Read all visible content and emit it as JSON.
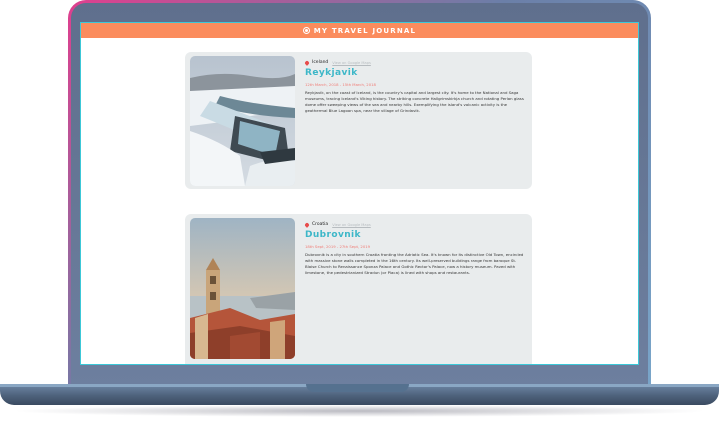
{
  "app": {
    "title": "MY TRAVEL JOURNAL"
  },
  "entries": [
    {
      "country": "Iceland",
      "map_link": "View on Google Maps",
      "title": "Reykjavik",
      "dates": "12th March, 2018 - 15th March, 2018",
      "description": "Reykjavik, on the coast of Iceland, is the country's capital and largest city. It's home to the National and Saga museums, tracing Iceland's Viking history. The striking concrete Hallgrimskirkja church and rotating Perlan glass dome offer sweeping views of the sea and nearby hills. Exemplifying the island's volcanic activity is the geothermal Blue Lagoon spa, near the village of Grindavik."
    },
    {
      "country": "Croatia",
      "map_link": "View on Google Maps",
      "title": "Dubrovnik",
      "dates": "18th Sept, 2019 - 27th Sept, 2019",
      "description": "Dubrovnik is a city in southern Croatia fronting the Adriatic Sea. It's known for its distinctive Old Town, encircled with massive stone walls completed in the 16th century. Its well-preserved buildings range from baroque St. Blaise Church to Renaissance Sponza Palace and Gothic Rector's Palace, now a history museum. Paved with limestone, the pedestrianized Stradun (or Placa) is lined with shops and restaurants."
    }
  ],
  "colors": {
    "header": "#fb8c5d",
    "title": "#3db7c8",
    "dates": "#f07c76",
    "pin": "#e74c4c",
    "card": "#e9eced"
  }
}
